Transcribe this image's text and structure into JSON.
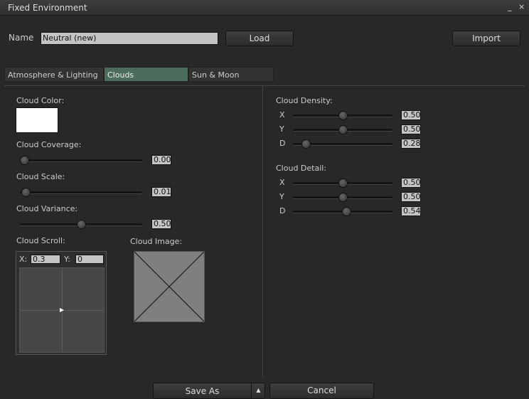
{
  "window": {
    "title": "Fixed Environment",
    "minimize": "_",
    "close": "×"
  },
  "name": {
    "label": "Name",
    "value": "Neutral (new)"
  },
  "buttons": {
    "load": "Load",
    "import": "Import",
    "save_as": "Save As",
    "cancel": "Cancel"
  },
  "tabs": [
    {
      "label": "Atmosphere & Lighting"
    },
    {
      "label": "Clouds",
      "active": true
    },
    {
      "label": "Sun & Moon"
    }
  ],
  "left": {
    "cloud_color_label": "Cloud Color:",
    "cloud_color": "#ffffff",
    "sliders": [
      {
        "label": "Cloud Coverage:",
        "value": "0.00",
        "num": 0,
        "max": 1
      },
      {
        "label": "Cloud Scale:",
        "value": "0.01",
        "num": 0.01,
        "max": 1
      },
      {
        "label": "Cloud Variance:",
        "value": "0.50",
        "num": 0.5,
        "max": 1
      }
    ],
    "scroll": {
      "label": "Cloud Scroll:",
      "x_label": "X:",
      "x": "0.3",
      "y_label": "Y:",
      "y": "0"
    },
    "image_label": "Cloud Image:"
  },
  "right": {
    "density": {
      "label": "Cloud Density:",
      "sliders": [
        {
          "axis": "X",
          "value": "0.50",
          "num": 0.5,
          "max": 1
        },
        {
          "axis": "Y",
          "value": "0.50",
          "num": 0.5,
          "max": 1
        },
        {
          "axis": "D",
          "value": "0.28",
          "num": 0.28,
          "max": 3
        }
      ]
    },
    "detail": {
      "label": "Cloud Detail:",
      "sliders": [
        {
          "axis": "X",
          "value": "0.50",
          "num": 0.5,
          "max": 1
        },
        {
          "axis": "Y",
          "value": "0.50",
          "num": 0.5,
          "max": 1
        },
        {
          "axis": "D",
          "value": "0.54",
          "num": 0.54,
          "max": 1
        }
      ]
    }
  }
}
